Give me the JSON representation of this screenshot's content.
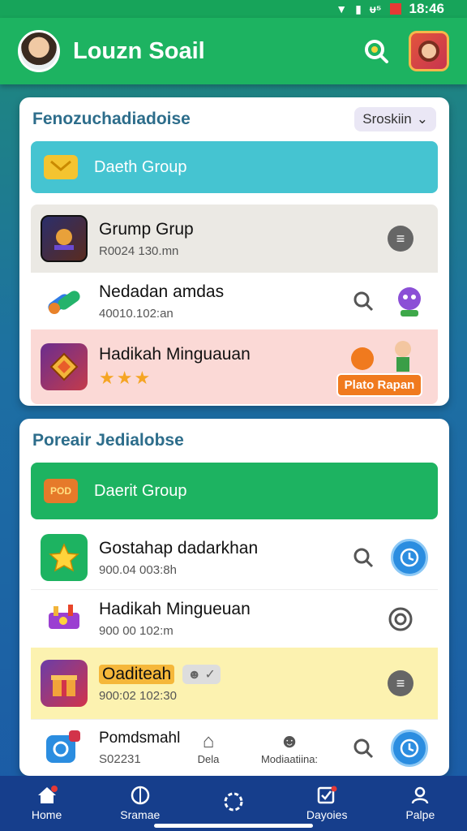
{
  "status_bar": {
    "time": "18:46",
    "signal_label": "ᵾ⁵"
  },
  "app_bar": {
    "title": "Louzn Soail"
  },
  "section1": {
    "title": "Fenozuchadiadoise",
    "dropdown_label": "Sroskiin",
    "group_bar_label": "Daeth Group",
    "rows": [
      {
        "name": "Grump Grup",
        "sub": "R0024 130.mn"
      },
      {
        "name": "Nedadan amdas",
        "sub": "40010.102:an"
      },
      {
        "name": "Hadikah Minguauan",
        "stars": "★★★",
        "badge": "Plato Rapan"
      }
    ]
  },
  "section2": {
    "title": "Poreair Jedialobse",
    "group_bar_label": "Daerit Group",
    "group_bar_badge": "POD",
    "rows": [
      {
        "name": "Gostahap dadarkhan",
        "sub": "900.04 003:8h"
      },
      {
        "name": "Hadikah Mingueuan",
        "sub": "900 00 102:m"
      },
      {
        "name": "Oaditeah",
        "sub": "900:02 102:30"
      },
      {
        "name": "Pomdsmahl",
        "sub": "S02231",
        "mid_label_1": "Dela",
        "mid_label_2": "Modiaatiina:"
      }
    ]
  },
  "bottom_nav": [
    {
      "label": "Home"
    },
    {
      "label": "Sramae"
    },
    {
      "label": ""
    },
    {
      "label": "Dayoies"
    },
    {
      "label": "Palpe"
    }
  ],
  "colors": {
    "brand_green": "#1db361",
    "teal": "#45c4d1",
    "nav_blue": "#163e8c"
  }
}
